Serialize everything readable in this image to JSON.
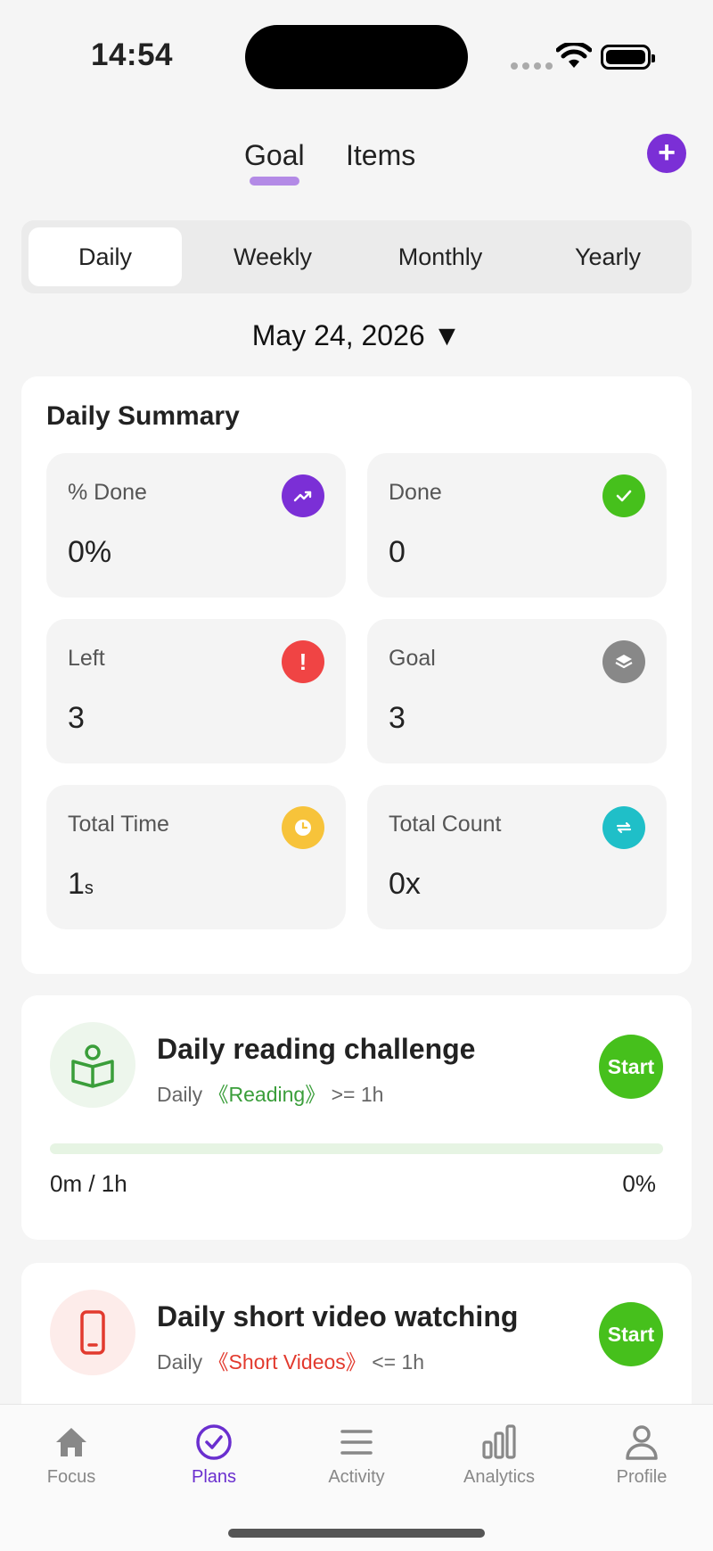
{
  "status": {
    "time": "14:54"
  },
  "tabs": {
    "goal": "Goal",
    "items": "Items",
    "add": "+"
  },
  "segments": [
    {
      "label": "Daily",
      "active": true
    },
    {
      "label": "Weekly",
      "active": false
    },
    {
      "label": "Monthly",
      "active": false
    },
    {
      "label": "Yearly",
      "active": false
    }
  ],
  "date": {
    "label": "May 24, 2026 ▼"
  },
  "summary": {
    "title": "Daily Summary",
    "stats": {
      "pct_done": {
        "label": "% Done",
        "value": "0%",
        "color": "#7b2fd6",
        "icon": "trend-up-icon"
      },
      "done": {
        "label": "Done",
        "value": "0",
        "color": "#46c01c",
        "icon": "check-icon"
      },
      "left": {
        "label": "Left",
        "value": "3",
        "color": "#f04444",
        "icon": "exclamation-icon"
      },
      "goal": {
        "label": "Goal",
        "value": "3",
        "color": "#888888",
        "icon": "layers-icon"
      },
      "total_time": {
        "label": "Total Time",
        "value": "1",
        "unit": "s",
        "color": "#f7c33a",
        "icon": "clock-icon"
      },
      "total_count": {
        "label": "Total Count",
        "value": "0x",
        "color": "#1fbfc8",
        "icon": "repeat-icon"
      }
    }
  },
  "goals": [
    {
      "title": "Daily reading challenge",
      "period": "Daily",
      "tag": "《Reading》",
      "rule": ">= 1h",
      "progress_text": "0m / 1h",
      "percent": "0%",
      "progress": 0,
      "start_label": "Start"
    },
    {
      "title": "Daily short video watching",
      "period": "Daily",
      "tag": "《Short Videos》",
      "rule": "<= 1h",
      "start_label": "Start"
    }
  ],
  "nav": [
    {
      "label": "Focus",
      "active": false
    },
    {
      "label": "Plans",
      "active": true
    },
    {
      "label": "Activity",
      "active": false
    },
    {
      "label": "Analytics",
      "active": false
    },
    {
      "label": "Profile",
      "active": false
    }
  ]
}
